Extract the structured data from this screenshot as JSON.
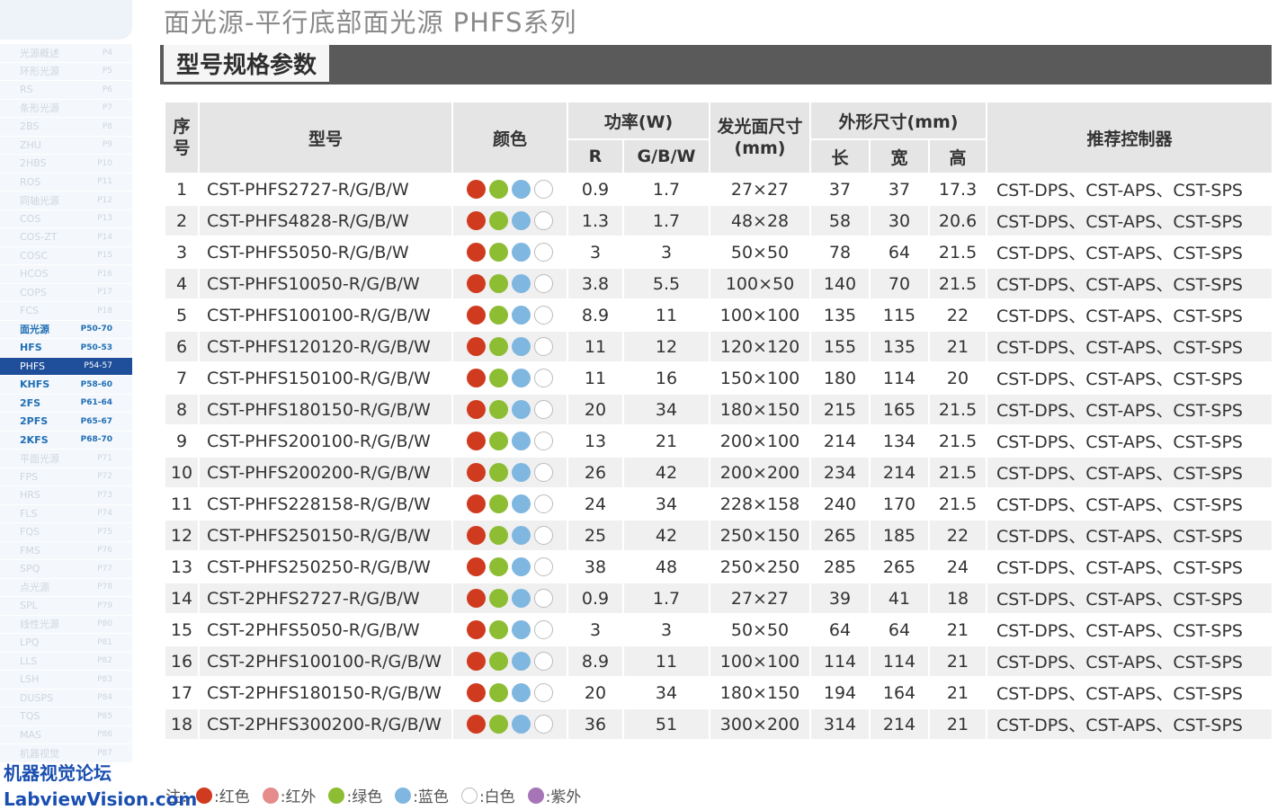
{
  "title": "面光源-平行底部面光源 PHFS系列",
  "section_label": "型号规格参数",
  "colors": {
    "red": "#d03a1e",
    "green": "#8dbd33",
    "blue": "#7fb7e0",
    "white": "#ffffff",
    "ir": "#e58b8b",
    "uv": "#a675b8"
  },
  "sidebar": {
    "items": [
      {
        "label": "光源概述",
        "page": "P4"
      },
      {
        "label": "环形光源",
        "page": "P5"
      },
      {
        "label": "RS",
        "page": "P6"
      },
      {
        "label": "条形光源",
        "page": "P7"
      },
      {
        "label": "2BS",
        "page": "P8"
      },
      {
        "label": "ZHU",
        "page": "P9"
      },
      {
        "label": "2HBS",
        "page": "P10"
      },
      {
        "label": "ROS",
        "page": "P11"
      },
      {
        "label": "同轴光源",
        "page": "P12"
      },
      {
        "label": "COS",
        "page": "P13"
      },
      {
        "label": "COS-ZT",
        "page": "P14"
      },
      {
        "label": "COSC",
        "page": "P15"
      },
      {
        "label": "HCOS",
        "page": "P16"
      },
      {
        "label": "COPS",
        "page": "P17"
      },
      {
        "label": "FCS",
        "page": "P18"
      },
      {
        "label": "面光源",
        "page": "P50-70",
        "style": "blue"
      },
      {
        "label": "HFS",
        "page": "P50-53",
        "style": "blue"
      },
      {
        "label": "PHFS",
        "page": "P54-57",
        "style": "active"
      },
      {
        "label": "KHFS",
        "page": "P58-60",
        "style": "blue"
      },
      {
        "label": "2FS",
        "page": "P61-64",
        "style": "blue"
      },
      {
        "label": "2PFS",
        "page": "P65-67",
        "style": "blue"
      },
      {
        "label": "2KFS",
        "page": "P68-70",
        "style": "blue"
      },
      {
        "label": "平面光源",
        "page": "P71"
      },
      {
        "label": "FPS",
        "page": "P72"
      },
      {
        "label": "HRS",
        "page": "P73"
      },
      {
        "label": "FLS",
        "page": "P74"
      },
      {
        "label": "FQS",
        "page": "P75"
      },
      {
        "label": "FMS",
        "page": "P76"
      },
      {
        "label": "SPQ",
        "page": "P77"
      },
      {
        "label": "点光源",
        "page": "P78"
      },
      {
        "label": "SPL",
        "page": "P79"
      },
      {
        "label": "线性光源",
        "page": "P80"
      },
      {
        "label": "LPQ",
        "page": "P81"
      },
      {
        "label": "LLS",
        "page": "P82"
      },
      {
        "label": "LSH",
        "page": "P83"
      },
      {
        "label": "DUSPS",
        "page": "P84"
      },
      {
        "label": "TQS",
        "page": "P85"
      },
      {
        "label": "MAS",
        "page": "P86"
      },
      {
        "label": "机器视觉",
        "page": "P87"
      }
    ]
  },
  "table": {
    "headers": {
      "index": "序号",
      "model": "型号",
      "color": "颜色",
      "power": "功率(W)",
      "power_r": "R",
      "power_gbw": "G/B/W",
      "emit_size": "发光面尺寸(mm)",
      "outer_size": "外形尺寸(mm)",
      "length": "长",
      "width": "宽",
      "height": "高",
      "controller": "推荐控制器"
    },
    "rows": [
      {
        "idx": "1",
        "model": "CST-PHFS2727-R/G/B/W",
        "r": "0.9",
        "gbw": "1.7",
        "emit": "27×27",
        "l": "37",
        "w": "37",
        "h": "17.3",
        "ctrl": "CST-DPS、CST-APS、CST-SPS"
      },
      {
        "idx": "2",
        "model": "CST-PHFS4828-R/G/B/W",
        "r": "1.3",
        "gbw": "1.7",
        "emit": "48×28",
        "l": "58",
        "w": "30",
        "h": "20.6",
        "ctrl": "CST-DPS、CST-APS、CST-SPS"
      },
      {
        "idx": "3",
        "model": "CST-PHFS5050-R/G/B/W",
        "r": "3",
        "gbw": "3",
        "emit": "50×50",
        "l": "78",
        "w": "64",
        "h": "21.5",
        "ctrl": "CST-DPS、CST-APS、CST-SPS"
      },
      {
        "idx": "4",
        "model": "CST-PHFS10050-R/G/B/W",
        "r": "3.8",
        "gbw": "5.5",
        "emit": "100×50",
        "l": "140",
        "w": "70",
        "h": "21.5",
        "ctrl": "CST-DPS、CST-APS、CST-SPS"
      },
      {
        "idx": "5",
        "model": "CST-PHFS100100-R/G/B/W",
        "r": "8.9",
        "gbw": "11",
        "emit": "100×100",
        "l": "135",
        "w": "115",
        "h": "22",
        "ctrl": "CST-DPS、CST-APS、CST-SPS"
      },
      {
        "idx": "6",
        "model": "CST-PHFS120120-R/G/B/W",
        "r": "11",
        "gbw": "12",
        "emit": "120×120",
        "l": "155",
        "w": "135",
        "h": "21",
        "ctrl": "CST-DPS、CST-APS、CST-SPS"
      },
      {
        "idx": "7",
        "model": "CST-PHFS150100-R/G/B/W",
        "r": "11",
        "gbw": "16",
        "emit": "150×100",
        "l": "180",
        "w": "114",
        "h": "20",
        "ctrl": "CST-DPS、CST-APS、CST-SPS"
      },
      {
        "idx": "8",
        "model": "CST-PHFS180150-R/G/B/W",
        "r": "20",
        "gbw": "34",
        "emit": "180×150",
        "l": "215",
        "w": "165",
        "h": "21.5",
        "ctrl": "CST-DPS、CST-APS、CST-SPS"
      },
      {
        "idx": "9",
        "model": "CST-PHFS200100-R/G/B/W",
        "r": "13",
        "gbw": "21",
        "emit": "200×100",
        "l": "214",
        "w": "134",
        "h": "21.5",
        "ctrl": "CST-DPS、CST-APS、CST-SPS"
      },
      {
        "idx": "10",
        "model": "CST-PHFS200200-R/G/B/W",
        "r": "26",
        "gbw": "42",
        "emit": "200×200",
        "l": "234",
        "w": "214",
        "h": "21.5",
        "ctrl": "CST-DPS、CST-APS、CST-SPS"
      },
      {
        "idx": "11",
        "model": "CST-PHFS228158-R/G/B/W",
        "r": "24",
        "gbw": "34",
        "emit": "228×158",
        "l": "240",
        "w": "170",
        "h": "21.5",
        "ctrl": "CST-DPS、CST-APS、CST-SPS"
      },
      {
        "idx": "12",
        "model": "CST-PHFS250150-R/G/B/W",
        "r": "25",
        "gbw": "42",
        "emit": "250×150",
        "l": "265",
        "w": "185",
        "h": "22",
        "ctrl": "CST-DPS、CST-APS、CST-SPS"
      },
      {
        "idx": "13",
        "model": "CST-PHFS250250-R/G/B/W",
        "r": "38",
        "gbw": "48",
        "emit": "250×250",
        "l": "285",
        "w": "265",
        "h": "24",
        "ctrl": "CST-DPS、CST-APS、CST-SPS"
      },
      {
        "idx": "14",
        "model": "CST-2PHFS2727-R/G/B/W",
        "r": "0.9",
        "gbw": "1.7",
        "emit": "27×27",
        "l": "39",
        "w": "41",
        "h": "18",
        "ctrl": "CST-DPS、CST-APS、CST-SPS"
      },
      {
        "idx": "15",
        "model": "CST-2PHFS5050-R/G/B/W",
        "r": "3",
        "gbw": "3",
        "emit": "50×50",
        "l": "64",
        "w": "64",
        "h": "21",
        "ctrl": "CST-DPS、CST-APS、CST-SPS"
      },
      {
        "idx": "16",
        "model": "CST-2PHFS100100-R/G/B/W",
        "r": "8.9",
        "gbw": "11",
        "emit": "100×100",
        "l": "114",
        "w": "114",
        "h": "21",
        "ctrl": "CST-DPS、CST-APS、CST-SPS"
      },
      {
        "idx": "17",
        "model": "CST-2PHFS180150-R/G/B/W",
        "r": "20",
        "gbw": "34",
        "emit": "180×150",
        "l": "194",
        "w": "164",
        "h": "21",
        "ctrl": "CST-DPS、CST-APS、CST-SPS"
      },
      {
        "idx": "18",
        "model": "CST-2PHFS300200-R/G/B/W",
        "r": "36",
        "gbw": "51",
        "emit": "300×200",
        "l": "314",
        "w": "214",
        "h": "21",
        "ctrl": "CST-DPS、CST-APS、CST-SPS"
      }
    ]
  },
  "legend": {
    "prefix": "注：",
    "items": [
      {
        "color": "red",
        "label": ":红色"
      },
      {
        "color": "ir",
        "label": ":红外"
      },
      {
        "color": "green",
        "label": ":绿色"
      },
      {
        "color": "blue",
        "label": ":蓝色"
      },
      {
        "color": "white",
        "label": ":白色"
      },
      {
        "color": "uv",
        "label": ":紫外"
      }
    ]
  },
  "watermark": {
    "line1": "机器视觉论坛",
    "line2": "LabviewVision.com"
  }
}
